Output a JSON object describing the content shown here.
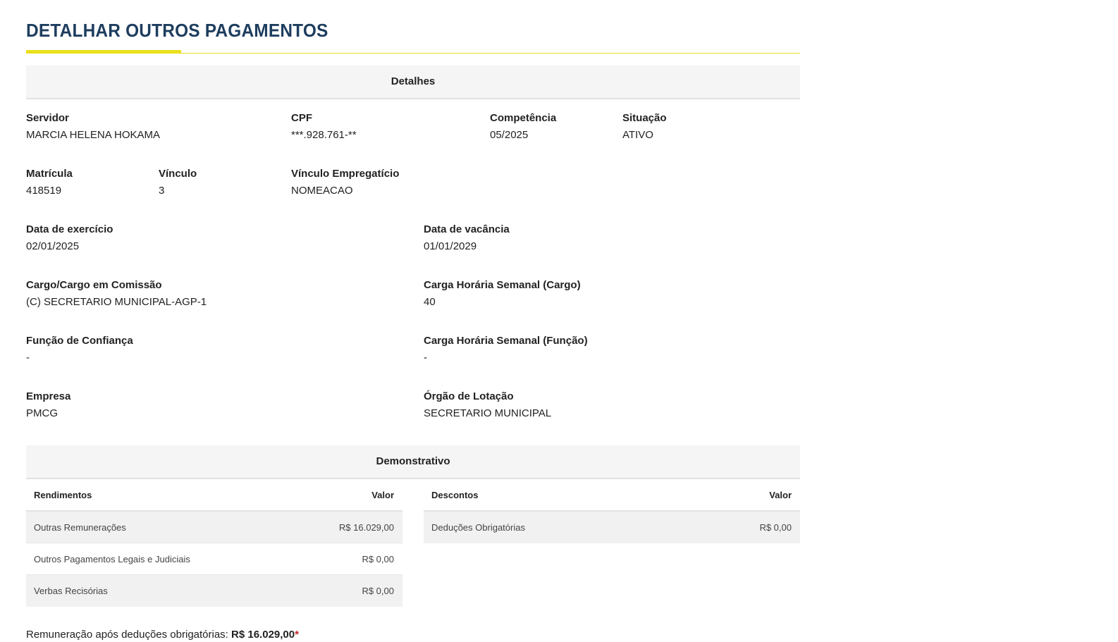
{
  "page": {
    "title": "DETALHAR OUTROS PAGAMENTOS"
  },
  "details": {
    "header": "Detalhes",
    "servidor": {
      "label": "Servidor",
      "value": "MARCIA HELENA HOKAMA"
    },
    "cpf": {
      "label": "CPF",
      "value": "***.928.761-**"
    },
    "competencia": {
      "label": "Competência",
      "value": "05/2025"
    },
    "situacao": {
      "label": "Situação",
      "value": "ATIVO"
    },
    "matricula": {
      "label": "Matrícula",
      "value": "418519"
    },
    "vinculo": {
      "label": "Vínculo",
      "value": "3"
    },
    "vinculo_empregaticio": {
      "label": "Vínculo Empregatício",
      "value": "NOMEACAO"
    },
    "data_exercicio": {
      "label": "Data de exercício",
      "value": "02/01/2025"
    },
    "data_vacancia": {
      "label": "Data de vacância",
      "value": "01/01/2029"
    },
    "cargo": {
      "label": "Cargo/Cargo em Comissão",
      "value": "(C) SECRETARIO MUNICIPAL-AGP-1"
    },
    "carga_cargo": {
      "label": "Carga Horária Semanal (Cargo)",
      "value": "40"
    },
    "funcao_confianca": {
      "label": "Função de Confiança",
      "value": "-"
    },
    "carga_funcao": {
      "label": "Carga Horária Semanal (Função)",
      "value": "-"
    },
    "empresa": {
      "label": "Empresa",
      "value": "PMCG"
    },
    "orgao_lotacao": {
      "label": "Órgão de Lotação",
      "value": "SECRETARIO MUNICIPAL"
    }
  },
  "demonstrativo": {
    "header": "Demonstrativo",
    "rendimentos": {
      "col_name": "Rendimentos",
      "col_value": "Valor",
      "rows": [
        {
          "name": "Outras Remunerações",
          "value": "R$ 16.029,00"
        },
        {
          "name": "Outros Pagamentos Legais e Judiciais",
          "value": "R$ 0,00"
        },
        {
          "name": "Verbas Recisórias",
          "value": "R$ 0,00"
        }
      ]
    },
    "descontos": {
      "col_name": "Descontos",
      "col_value": "Valor",
      "rows": [
        {
          "name": "Deduções Obrigatórias",
          "value": "R$ 0,00"
        }
      ]
    }
  },
  "footer": {
    "text": "Remuneração após deduções obrigatórias:",
    "amount": "R$ 16.029,00",
    "asterisk": "*"
  },
  "colors": {
    "title": "#1d3d5e",
    "accent": "#e9e01c",
    "header_bg": "#f5f5f5",
    "row_shade": "#f1f1f1"
  }
}
